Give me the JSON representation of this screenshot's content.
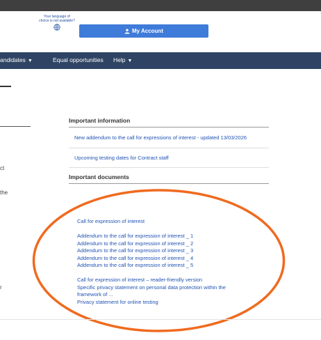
{
  "header": {
    "language_note": "Your language of choice is not available?",
    "account_button": "My Account"
  },
  "nav": {
    "items": [
      {
        "label": "andidates",
        "caret": "▼"
      },
      {
        "label": "Equal opportunities",
        "caret": ""
      },
      {
        "label": "Help",
        "caret": "▼"
      }
    ]
  },
  "left_fragments": [
    "ct",
    "the",
    "r"
  ],
  "information": {
    "heading": "Important information",
    "links": [
      "New addendum to the call for expressions of interest - updated 13/03/2026",
      "Upcoming testing dates for Contract staff"
    ]
  },
  "documents": {
    "heading": "Important documents",
    "group1": [
      "Call for expression of interest"
    ],
    "group2": [
      "Addendum to the call for expression of interest _ 1",
      "Addendum to the call for expression of interest _ 2",
      "Addendum to the call for expression of interest _ 3",
      "Addendum to the call for expression of interest _ 4",
      "Addendum to the call for expression of interest _ 5"
    ],
    "group3": [
      "Call for expression of interest – reader-friendly version",
      "Specific privacy statement on personal data protection within the",
      "framework of ...",
      "Privacy statement for online testing"
    ]
  },
  "colors": {
    "navbar": "#2f4464",
    "button": "#3f7bd9",
    "link": "#2053b3",
    "highlight_ellipse": "#f06a1e"
  },
  "icons": [
    "globe-icon",
    "user-icon",
    "chevron-down-icon"
  ]
}
